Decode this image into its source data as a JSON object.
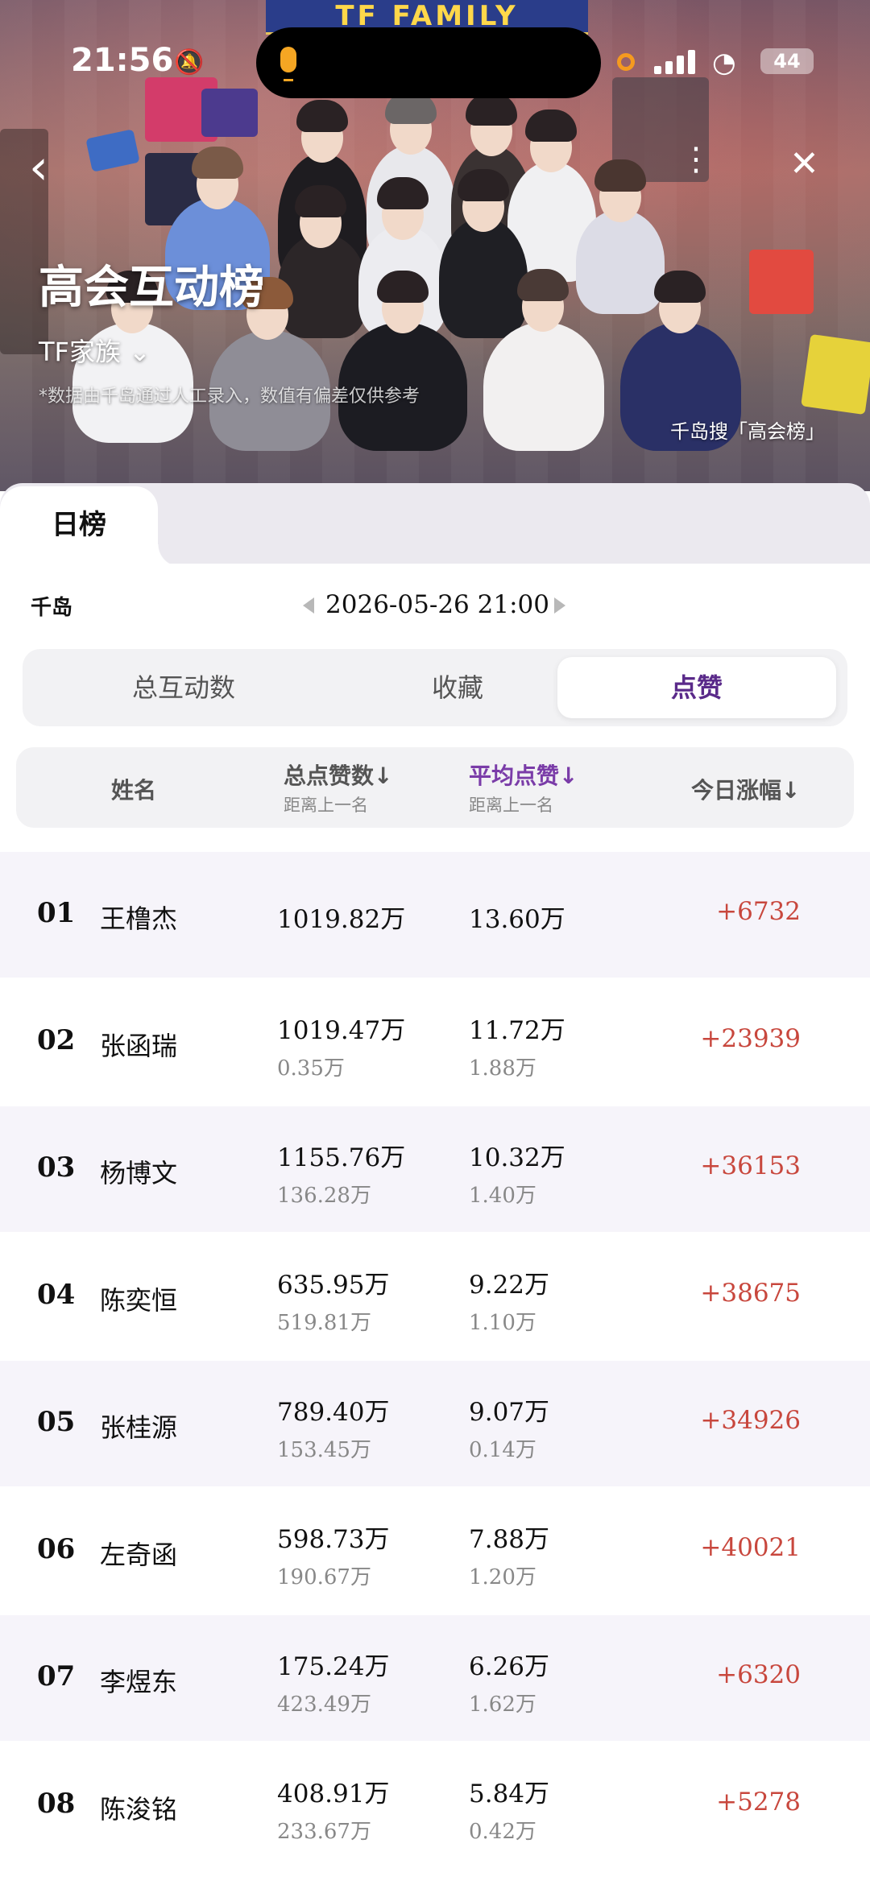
{
  "status_bar": {
    "time": "21:56",
    "battery": "44"
  },
  "header": {
    "sign_text": "TF FAMILY",
    "title": "高会互动榜",
    "subtitle": "TF家族 ⌄",
    "disclaimer": "*数据由千岛通过人工录入，数值有偏差仅供参考",
    "credit": "千岛搜「高会榜」"
  },
  "tabs": {
    "active": "日榜"
  },
  "source_label": "千岛",
  "date": "2026-05-26 21:00",
  "segments": [
    "总互动数",
    "收藏",
    "点赞"
  ],
  "segment_selected": "点赞",
  "table": {
    "headers": {
      "name": "姓名",
      "total": "总点赞数↓",
      "total_sub": "距离上一名",
      "avg": "平均点赞↓",
      "avg_sub": "距离上一名",
      "today": "今日涨幅↓"
    },
    "rows": [
      {
        "rank": "01",
        "name": "王橹杰",
        "total": "1019.82万",
        "total_gap": "",
        "avg": "13.60万",
        "avg_gap": "",
        "change": "+6732"
      },
      {
        "rank": "02",
        "name": "张函瑞",
        "total": "1019.47万",
        "total_gap": "0.35万",
        "avg": "11.72万",
        "avg_gap": "1.88万",
        "change": "+23939"
      },
      {
        "rank": "03",
        "name": "杨博文",
        "total": "1155.76万",
        "total_gap": "136.28万",
        "avg": "10.32万",
        "avg_gap": "1.40万",
        "change": "+36153"
      },
      {
        "rank": "04",
        "name": "陈奕恒",
        "total": "635.95万",
        "total_gap": "519.81万",
        "avg": "9.22万",
        "avg_gap": "1.10万",
        "change": "+38675"
      },
      {
        "rank": "05",
        "name": "张桂源",
        "total": "789.40万",
        "total_gap": "153.45万",
        "avg": "9.07万",
        "avg_gap": "0.14万",
        "change": "+34926"
      },
      {
        "rank": "06",
        "name": "左奇函",
        "total": "598.73万",
        "total_gap": "190.67万",
        "avg": "7.88万",
        "avg_gap": "1.20万",
        "change": "+40021"
      },
      {
        "rank": "07",
        "name": "李煜东",
        "total": "175.24万",
        "total_gap": "423.49万",
        "avg": "6.26万",
        "avg_gap": "1.62万",
        "change": "+6320"
      },
      {
        "rank": "08",
        "name": "陈浚铭",
        "total": "408.91万",
        "total_gap": "233.67万",
        "avg": "5.84万",
        "avg_gap": "0.42万",
        "change": "+5278"
      }
    ]
  },
  "colors": {
    "accent_purple": "#7a3ca8",
    "change_red": "#c8473d",
    "row_alt": "#f6f4fa"
  }
}
